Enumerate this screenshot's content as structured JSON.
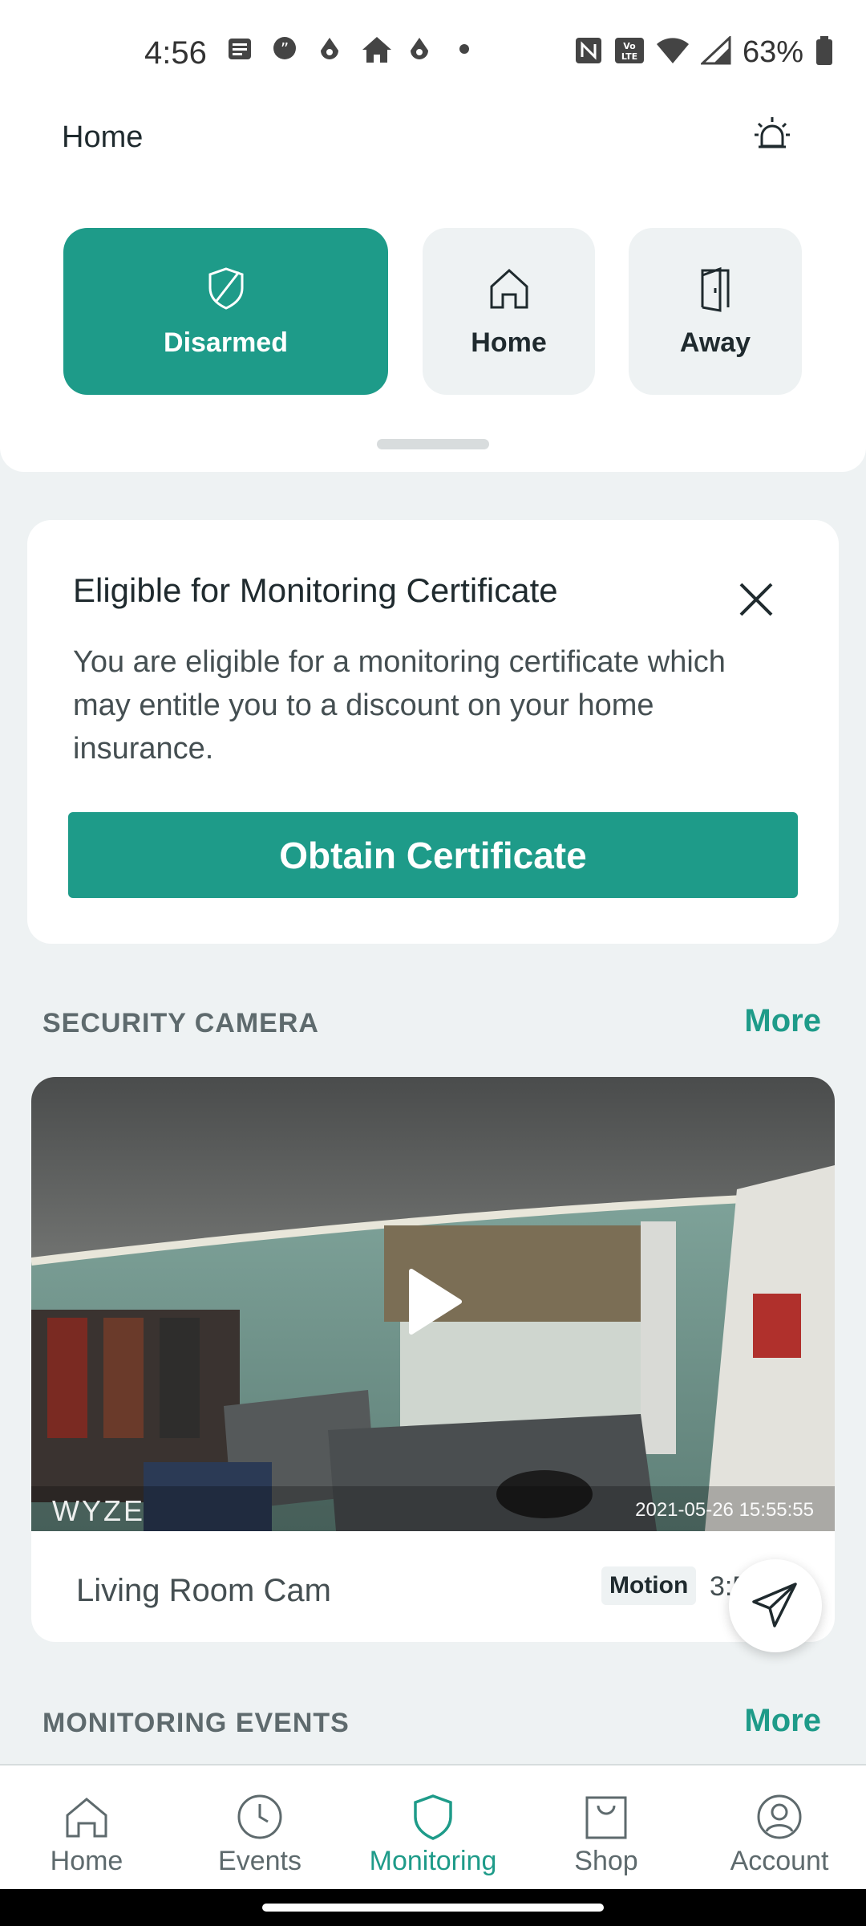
{
  "status_bar": {
    "time": "4:56",
    "battery_text": "63%",
    "left_icons": [
      "message-icon",
      "quote-icon",
      "drop-icon",
      "home-icon",
      "drop-icon",
      "dot-icon"
    ],
    "right_icons": [
      "nfc-icon",
      "volte-icon",
      "wifi-icon",
      "signal-icon",
      "battery-icon"
    ]
  },
  "header": {
    "title": "Home",
    "alarm_icon": "alarm-icon"
  },
  "modes": [
    {
      "label": "Disarmed",
      "icon": "shield-off-icon",
      "active": true
    },
    {
      "label": "Home",
      "icon": "home-icon",
      "active": false
    },
    {
      "label": "Away",
      "icon": "door-icon",
      "active": false
    }
  ],
  "certificate_card": {
    "title": "Eligible for Monitoring Certificate",
    "body": "You are eligible for a monitoring certificate which may entitle you to a discount on your home insurance.",
    "button_label": "Obtain Certificate"
  },
  "security_camera": {
    "header": "SECURITY CAMERA",
    "more_label": "More",
    "camera": {
      "brand_watermark": "WYZE",
      "timestamp": "2021-05-26 15:55:55",
      "name": "Living Room Cam",
      "badge": "Motion",
      "time_partial": "3:5"
    }
  },
  "monitoring_events": {
    "header": "MONITORING EVENTS",
    "more_label": "More"
  },
  "bottom_nav": {
    "items": [
      {
        "label": "Home",
        "icon": "home-icon",
        "active": false
      },
      {
        "label": "Events",
        "icon": "clock-icon",
        "active": false
      },
      {
        "label": "Monitoring",
        "icon": "shield-icon",
        "active": true
      },
      {
        "label": "Shop",
        "icon": "bag-icon",
        "active": false
      },
      {
        "label": "Account",
        "icon": "account-icon",
        "active": false
      }
    ]
  },
  "colors": {
    "accent": "#1e9b89",
    "background": "#eef2f3",
    "card": "#ffffff"
  }
}
